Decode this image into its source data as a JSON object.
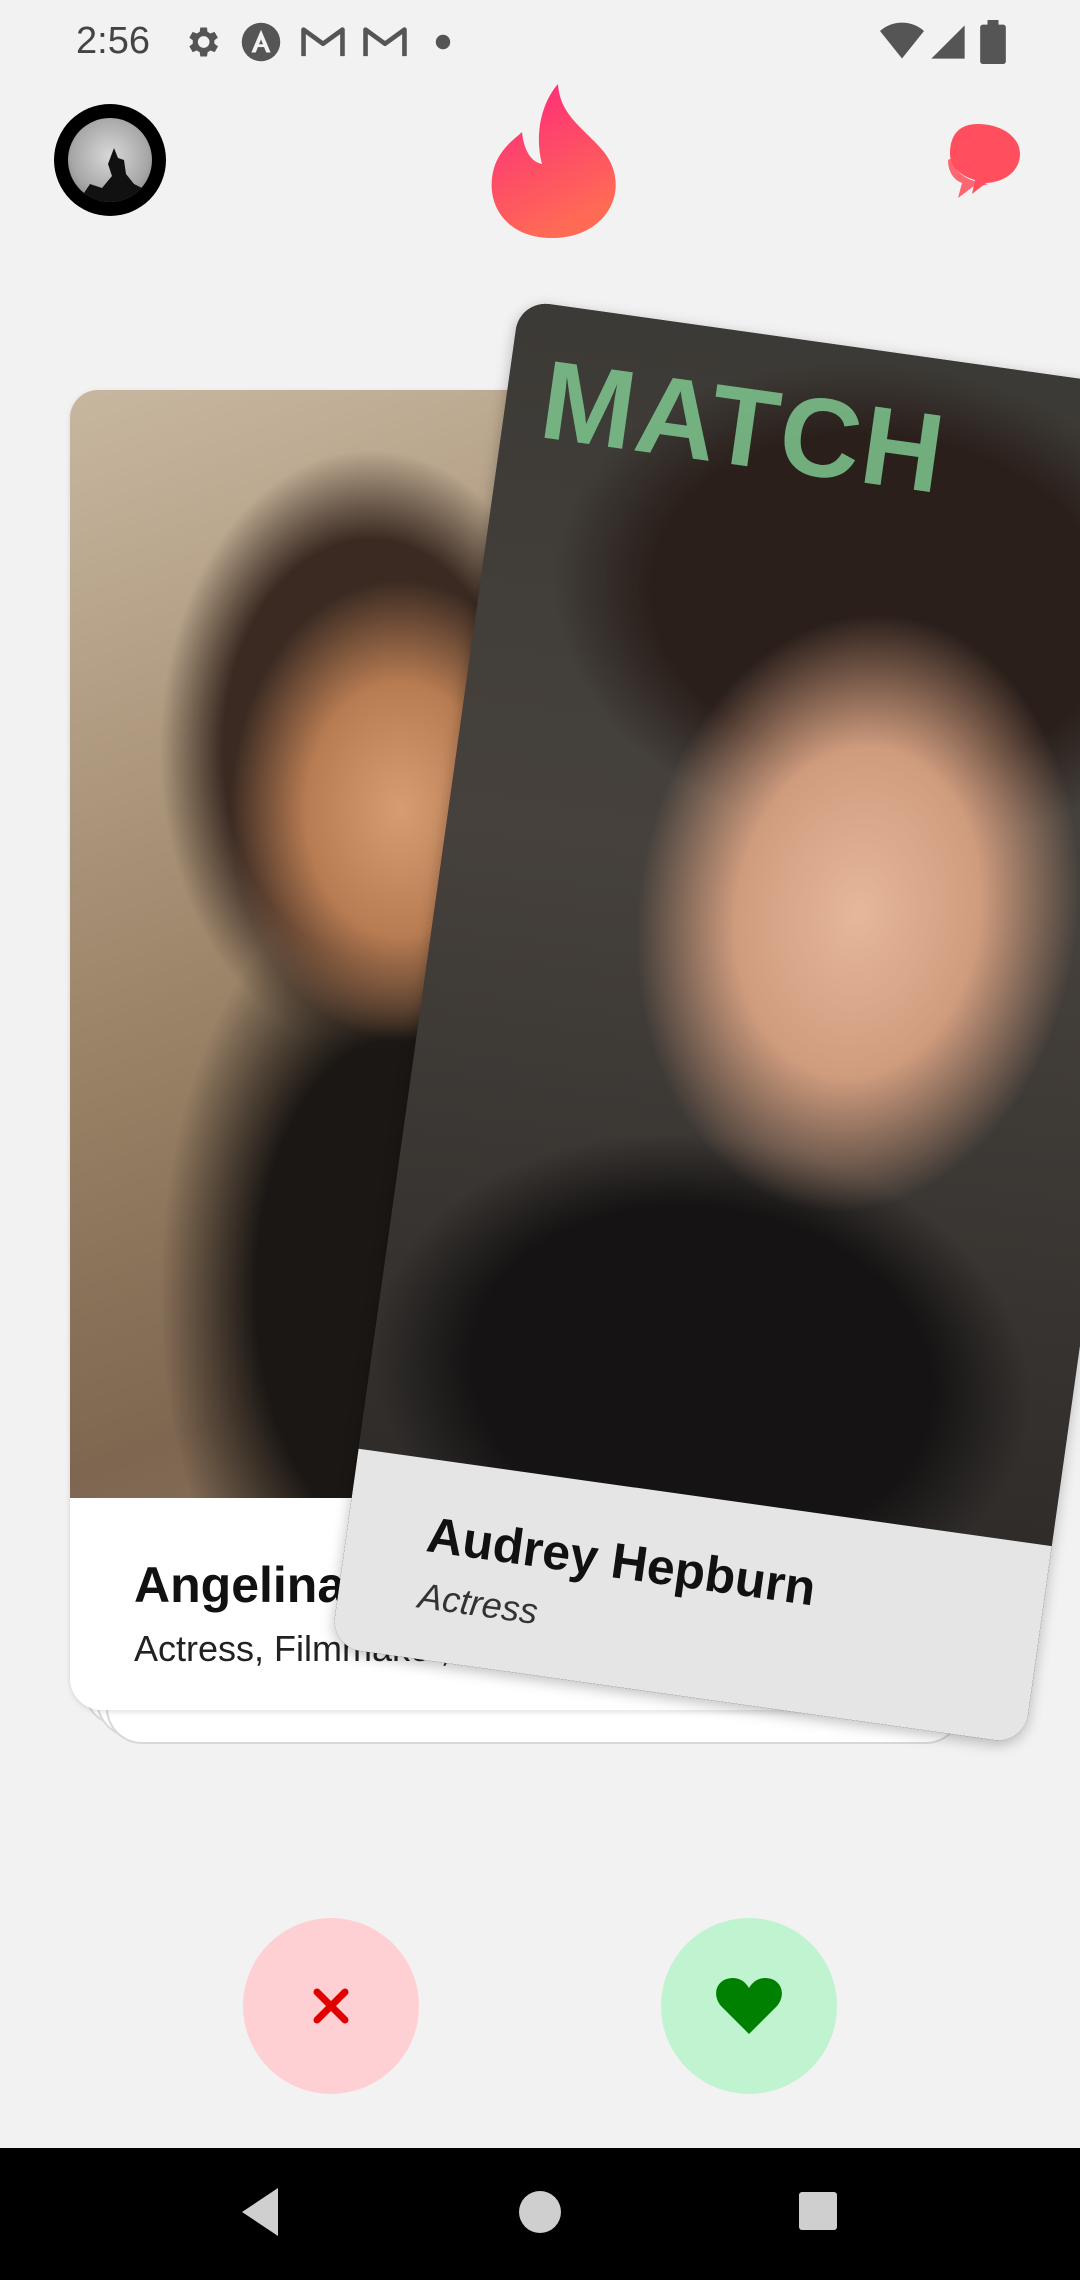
{
  "status_bar": {
    "time": "2:56",
    "left_icons": [
      "gear-icon",
      "android-icon",
      "gmail-icon",
      "gmail-icon",
      "dot-icon"
    ],
    "right_icons": [
      "wifi-icon",
      "signal-icon",
      "battery-icon"
    ]
  },
  "header": {
    "avatar": "wolf-moon-avatar",
    "logo": "flame-icon",
    "chat": "chat-icon"
  },
  "cards": {
    "front": {
      "name": "Angelina Jolie",
      "description": "Actress, Filmmaker, Humanitarian"
    },
    "swiping": {
      "name": "Audrey Hepburn",
      "description": "Actress",
      "overlay_label": "MATCH"
    }
  },
  "actions": {
    "nope_icon": "close-icon",
    "like_icon": "heart-icon"
  },
  "colors": {
    "background": "#f2f2f2",
    "brand_gradient_start": "#fd267d",
    "brand_gradient_end": "#ff7854",
    "nope_bg": "#ffd0d3",
    "nope_icon": "#e00000",
    "like_bg": "#c0f3d0",
    "like_icon": "#008000",
    "match_label": "#7fc78f"
  },
  "nav": [
    "back-icon",
    "home-icon",
    "recents-icon"
  ]
}
